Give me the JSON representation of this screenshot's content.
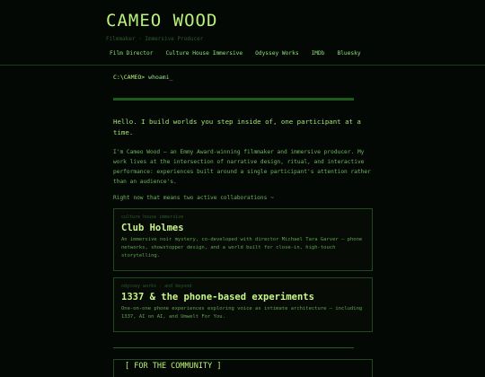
{
  "header": {
    "title": "CAMEO WOOD",
    "tagline": "Filmmaker · Immersive Producer",
    "nav": [
      "Film Director",
      "Culture House Immersive",
      "Odyssey Works",
      "IMDb",
      "Bluesky"
    ]
  },
  "terminal": {
    "path": "C:\\CAMEO>",
    "command": "whoami_"
  },
  "intro": "Hello. I build worlds you step inside of, one participant at a time.",
  "bio": "I'm Cameo Wood — an Emmy Award-winning filmmaker and immersive producer. My work lives at the intersection of narrative design, ritual, and interactive performance: experiences built around a single participant's attention rather than an audience's.",
  "collab_lead": "Right now that means two active collaborations ~",
  "cards": [
    {
      "kicker": "culture house immersive",
      "title": "Club Holmes",
      "desc": "An immersive noir mystery, co-developed with director Michael Tara Garver — phone networks, showstopper design, and a world built for close-in, high-touch storytelling."
    },
    {
      "kicker": "odyssey works · and beyond",
      "title": "1337 & the phone-based experiments",
      "desc": "One-on-one phone experiences exploring voice as intimate architecture — including 1337, AI on AI, and Umwelt For You."
    }
  ],
  "community": "[ FOR THE COMMUNITY ]"
}
